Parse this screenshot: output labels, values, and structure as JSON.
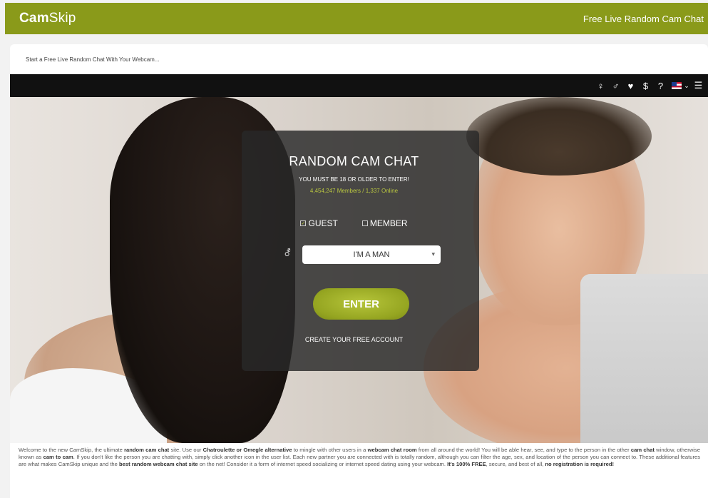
{
  "header": {
    "logo_bold": "Cam",
    "logo_light": "Skip",
    "tagline": "Free Live Random Cam Chat"
  },
  "subtitle": "Start a Free Live Random Chat With Your Webcam...",
  "nav": {
    "icons": [
      "female-icon",
      "male-icon",
      "heart-icon",
      "dollar-icon",
      "help-icon",
      "flag-icon",
      "menu-icon"
    ],
    "female": "♀",
    "male": "♂",
    "heart": "♥",
    "dollar": "$",
    "help": "?",
    "caret": "⌄",
    "menu": "☰"
  },
  "panel": {
    "title": "RANDOM CAM CHAT",
    "age_notice": "YOU MUST BE 18 OR OLDER TO ENTER!",
    "stats": "4,454,247 Members / 1,337 Online",
    "guest_label": "GUEST",
    "member_label": "MEMBER",
    "gender_symbol": "⚦",
    "select_value": "I'M A MAN",
    "enter_label": "ENTER",
    "create_account": "CREATE YOUR FREE ACCOUNT"
  },
  "colors": {
    "brand": "#8a9a1a",
    "accent": "#b9c640",
    "navbar": "#111111"
  },
  "description": {
    "p1": "Welcome to the new CamSkip, the ultimate ",
    "b1": "random cam chat",
    "p2": " site. Use our ",
    "b2": "Chatroulette or Omegle alternative",
    "p3": " to mingle with other users in a ",
    "b3": "webcam chat room",
    "p4": " from all around the world! You will be able hear, see, and type to the person in the other ",
    "b4": "cam chat",
    "p5": " window, otherwise known as ",
    "b5": "cam to cam",
    "p6": ". If you don't like the person you are chatting with, simply click another icon in the user list. Each new partner you are connected with is totally random, although you can filter the age, sex, and location of the person you can connect to. These additional features are what makes CamSkip unique and the ",
    "b6": "best random webcam chat site",
    "p7": " on the net! Consider it a form of internet speed socializing or internet speed dating using your webcam. ",
    "b7": "It's 100% FREE",
    "p8": ", secure, and best of all, ",
    "b8": "no registration is required!"
  }
}
